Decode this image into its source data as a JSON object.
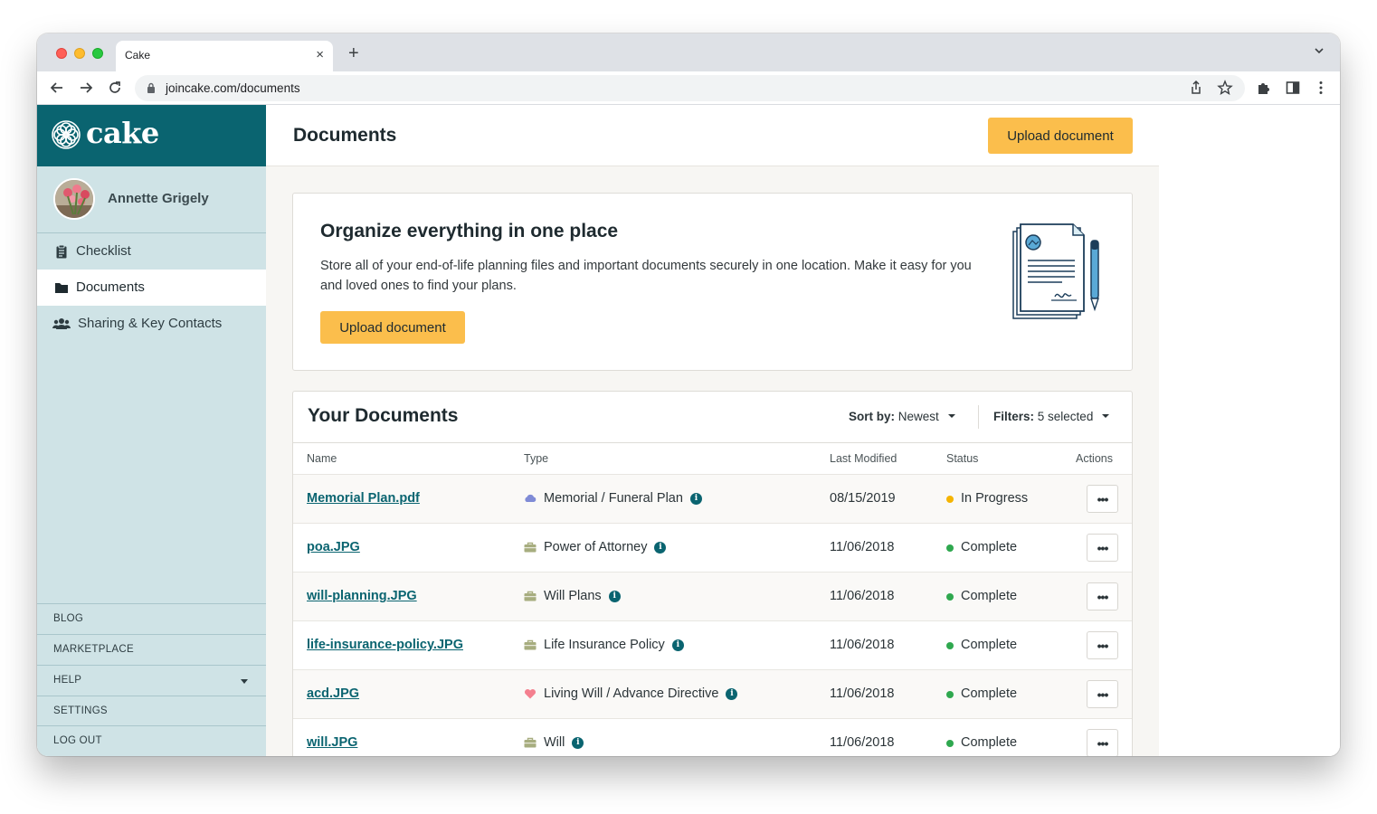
{
  "browser": {
    "tab_title": "Cake",
    "tab_close": "×",
    "new_tab": "+",
    "url": "joincake.com/documents"
  },
  "brand": {
    "logo_text": "cake",
    "primary_color": "#0a6470",
    "accent_color": "#fbbe4c"
  },
  "user": {
    "name": "Annette Grigely"
  },
  "sidebar": {
    "items": [
      {
        "label": "Checklist",
        "icon": "clipboard-icon"
      },
      {
        "label": "Documents",
        "icon": "folder-icon",
        "active": true
      },
      {
        "label": "Sharing & Key Contacts",
        "icon": "users-icon"
      }
    ],
    "footer": [
      {
        "label": "BLOG"
      },
      {
        "label": "MARKETPLACE"
      },
      {
        "label": "HELP"
      },
      {
        "label": "SETTINGS"
      },
      {
        "label": "LOG OUT"
      }
    ]
  },
  "header": {
    "title": "Documents",
    "upload_label": "Upload document"
  },
  "promo": {
    "title": "Organize everything in one place",
    "text": "Store all of your end-of-life planning files and important documents securely in one location. Make it easy for you and loved ones to find your plans.",
    "upload_label": "Upload document"
  },
  "documents": {
    "title": "Your Documents",
    "sort_label": "Sort by:",
    "sort_value": "Newest",
    "filters_label": "Filters:",
    "filters_value": "5 selected",
    "columns": [
      "Name",
      "Type",
      "Last Modified",
      "Status",
      "Actions"
    ],
    "rows": [
      {
        "name": "Memorial Plan.pdf",
        "type": "Memorial / Funeral Plan",
        "type_icon": "cloud-icon",
        "modified": "08/15/2019",
        "status": "In Progress",
        "status_color": "#f5b400"
      },
      {
        "name": "poa.JPG",
        "type": "Power of Attorney",
        "type_icon": "briefcase-icon",
        "modified": "11/06/2018",
        "status": "Complete",
        "status_color": "#2fa84f"
      },
      {
        "name": "will-planning.JPG",
        "type": "Will Plans",
        "type_icon": "briefcase-icon",
        "modified": "11/06/2018",
        "status": "Complete",
        "status_color": "#2fa84f"
      },
      {
        "name": "life-insurance-policy.JPG",
        "type": "Life Insurance Policy",
        "type_icon": "briefcase-icon",
        "modified": "11/06/2018",
        "status": "Complete",
        "status_color": "#2fa84f"
      },
      {
        "name": "acd.JPG",
        "type": "Living Will / Advance Directive",
        "type_icon": "heart-icon",
        "modified": "11/06/2018",
        "status": "Complete",
        "status_color": "#2fa84f"
      },
      {
        "name": "will.JPG",
        "type": "Will",
        "type_icon": "briefcase-icon",
        "modified": "11/06/2018",
        "status": "Complete",
        "status_color": "#2fa84f"
      }
    ],
    "action_label": "•••",
    "info_glyph": "i"
  }
}
